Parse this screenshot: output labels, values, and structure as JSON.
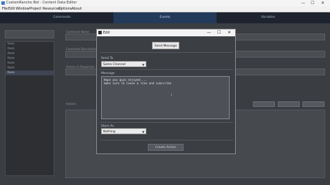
{
  "window": {
    "title": "CustomRancho Bot - Content Data Editor",
    "minimize": "—",
    "maximize": "☐",
    "close": "✕"
  },
  "menu": [
    "File",
    "Edit",
    "Window",
    "Project",
    "Resources",
    "Options",
    "About"
  ],
  "tabs": [
    {
      "label": "Commands"
    },
    {
      "label": "Events"
    },
    {
      "label": "Variables"
    }
  ],
  "left_panel": {
    "header": "",
    "items": [
      "Item",
      "Item",
      "Item",
      "Item",
      "Item",
      "Item",
      "Item"
    ],
    "selected_index": 6
  },
  "main": {
    "fields": [
      {
        "label": "Command Name"
      },
      {
        "label": "Command Description"
      },
      {
        "label": "Actions & Responses"
      }
    ],
    "actions_label": "Actions",
    "buttons": [
      "",
      "",
      "",
      ""
    ]
  },
  "dialog": {
    "title": "Edit",
    "send_button": "Send Message",
    "send_to_label": "Send To",
    "send_to_value": "Same Channel",
    "message_label": "Message",
    "message_lines": [
      "Hope you guys enjoyed....",
      "make sure to leave a like and subscribe"
    ],
    "store_label": "Store As",
    "store_value": "Nothing",
    "create_button": "Create Action",
    "minimize": "—",
    "maximize": "☐",
    "close": "✕"
  }
}
